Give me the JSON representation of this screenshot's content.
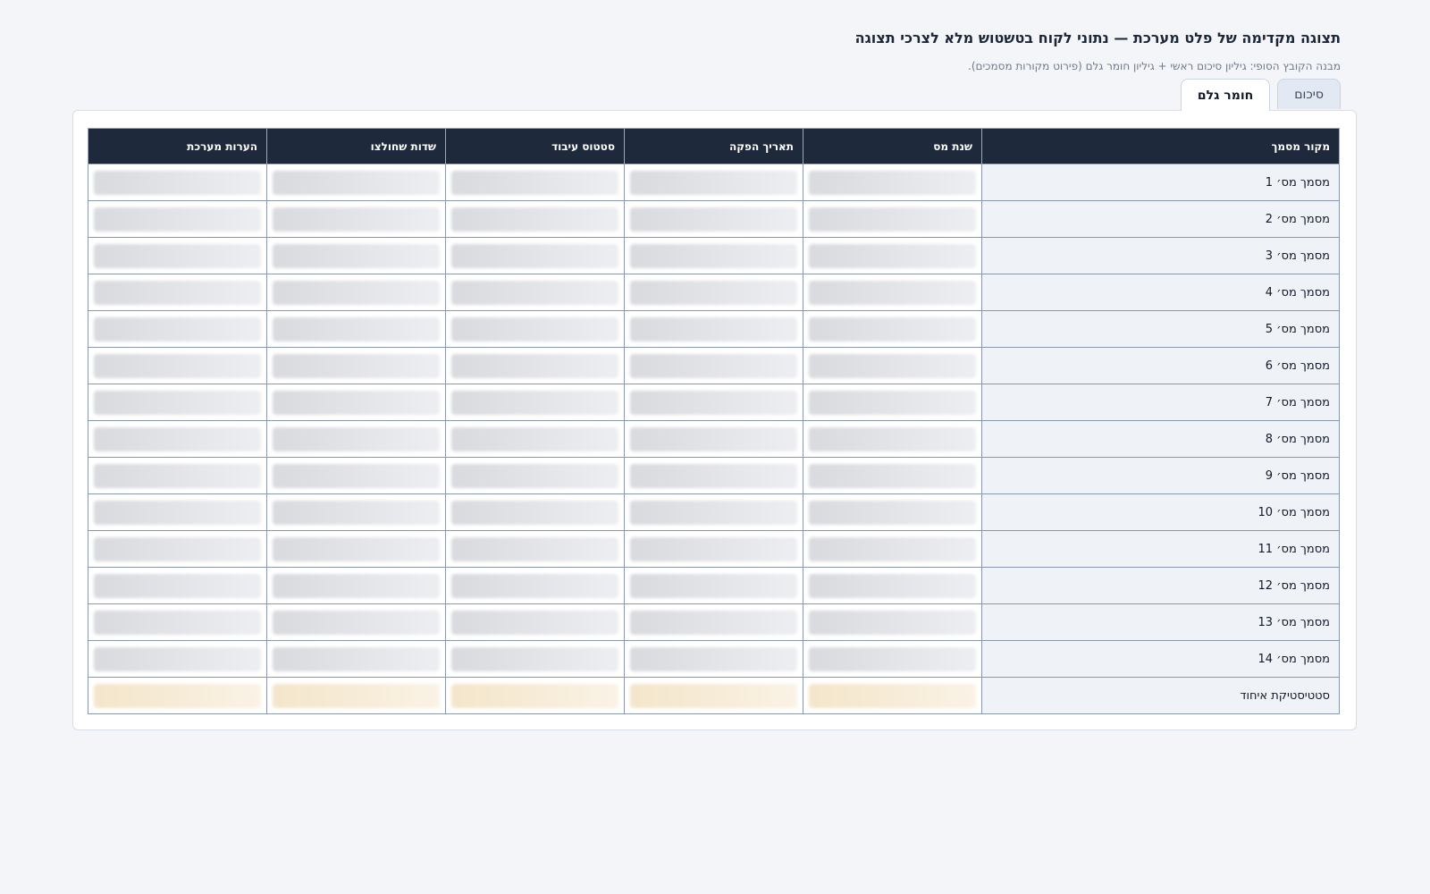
{
  "header": {
    "title": "תצוגה מקדימה של פלט מערכת — נתוני לקוח בטשטוש מלא לצרכי תצוגה",
    "subtitle": "מבנה הקובץ הסופי: גיליון סיכום ראשי + גיליון חומר גלם (פירוט מקורות מסמכים)."
  },
  "tabs": [
    {
      "label": "סיכום",
      "active": false
    },
    {
      "label": "חומר גלם",
      "active": true
    }
  ],
  "table": {
    "columns": [
      "מקור מסמך",
      "שנת מס",
      "תאריך הפקה",
      "סטטוס עיבוד",
      "שדות שחולצו",
      "הערות מערכת"
    ],
    "rows": [
      {
        "source": "מסמך מס׳ 1",
        "blurred": true
      },
      {
        "source": "מסמך מס׳ 2",
        "blurred": true
      },
      {
        "source": "מסמך מס׳ 3",
        "blurred": true
      },
      {
        "source": "מסמך מס׳ 4",
        "blurred": true
      },
      {
        "source": "מסמך מס׳ 5",
        "blurred": true
      },
      {
        "source": "מסמך מס׳ 6",
        "blurred": true
      },
      {
        "source": "מסמך מס׳ 7",
        "blurred": true
      },
      {
        "source": "מסמך מס׳ 8",
        "blurred": true
      },
      {
        "source": "מסמך מס׳ 9",
        "blurred": true
      },
      {
        "source": "מסמך מס׳ 10",
        "blurred": true
      },
      {
        "source": "מסמך מס׳ 11",
        "blurred": true
      },
      {
        "source": "מסמך מס׳ 12",
        "blurred": true
      },
      {
        "source": "מסמך מס׳ 13",
        "blurred": true
      },
      {
        "source": "מסמך מס׳ 14",
        "blurred": true
      },
      {
        "source": "סטטיסטיקת איחוד",
        "blurred": true,
        "highlight_color": "#f6e9d0"
      }
    ]
  }
}
